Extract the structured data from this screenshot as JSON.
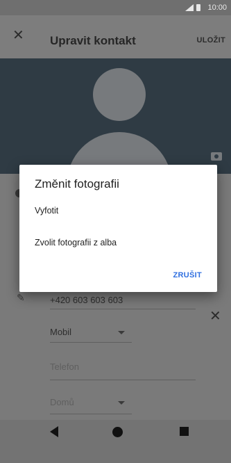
{
  "status_bar": {
    "time": "10:00",
    "signal_icon": "signal-icon",
    "battery_icon": "battery-icon"
  },
  "app_bar": {
    "title": "Upravit kontakt",
    "save_label": "ULOŽIT",
    "close_icon": "close-icon"
  },
  "header": {
    "avatar_icon": "avatar-placeholder",
    "camera_icon": "camera-icon"
  },
  "form": {
    "phone_value": "+420 603 603 603",
    "phone_type": "Mobil",
    "phone_placeholder": "Telefon",
    "email_type": "Domů"
  },
  "dialog": {
    "title": "Změnit fotografii",
    "options": [
      "Vyfotit",
      "Zvolit fotografii z alba"
    ],
    "cancel_label": "ZRUŠIT"
  },
  "colors": {
    "accent": "#2f6fe0",
    "header": "#2f3b44"
  }
}
